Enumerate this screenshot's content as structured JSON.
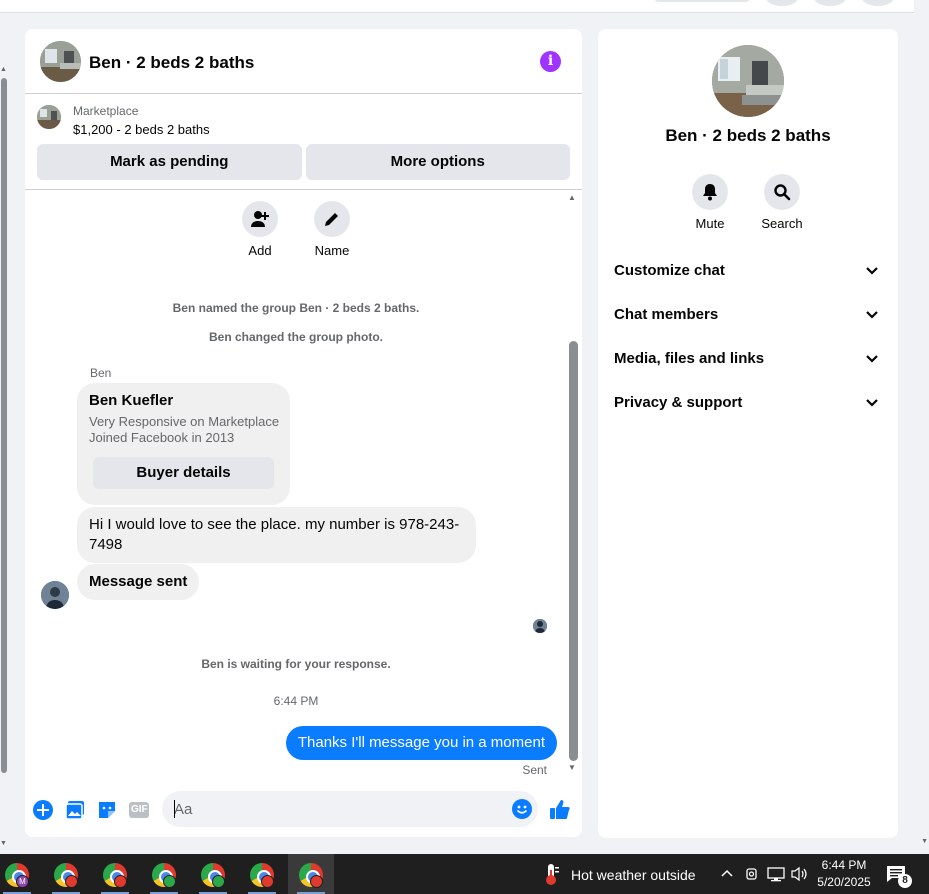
{
  "chat": {
    "title": "Ben · 2 beds 2 baths",
    "listing": {
      "source": "Marketplace",
      "price_title": "$1,200 - 2 beds 2 baths",
      "mark_pending": "Mark as pending",
      "more_options": "More options"
    },
    "actions": {
      "add": "Add",
      "name": "Name"
    },
    "system_messages": [
      "Ben named the group Ben · 2 beds 2 baths.",
      "Ben changed the group photo.",
      "Ben is waiting for your response."
    ],
    "sender_label": "Ben",
    "profile_card": {
      "name": "Ben Kuefler",
      "line1": "Very Responsive on Marketplace",
      "line2": "Joined Facebook in 2013",
      "button": "Buyer details"
    },
    "messages_in": [
      "Hi I would love to see the place. my number is 978-243-7498",
      "Message sent"
    ],
    "timestamp": "6:44 PM",
    "message_out": "Thanks I'll message you in a moment",
    "status": "Sent",
    "composer": {
      "placeholder": "Aa",
      "gif_label": "GIF"
    }
  },
  "info_panel": {
    "title": "Ben · 2 beds 2 baths",
    "mute": "Mute",
    "search": "Search",
    "sections": [
      "Customize chat",
      "Chat members",
      "Media, files and links",
      "Privacy & support"
    ]
  },
  "taskbar": {
    "weather": "Hot weather outside",
    "time": "6:44 PM",
    "date": "5/20/2025",
    "notifications": "8",
    "profile_badges": [
      "M",
      "",
      "",
      "",
      "",
      "",
      ""
    ],
    "profile_colors": [
      "#8e44ad",
      "#e0392d",
      "#e0392d",
      "#2aa84a",
      "#2aa84a",
      "#e0392d",
      "#e0392d"
    ]
  },
  "colors": {
    "accent": "#0a7cff",
    "info": "#a033ff"
  }
}
